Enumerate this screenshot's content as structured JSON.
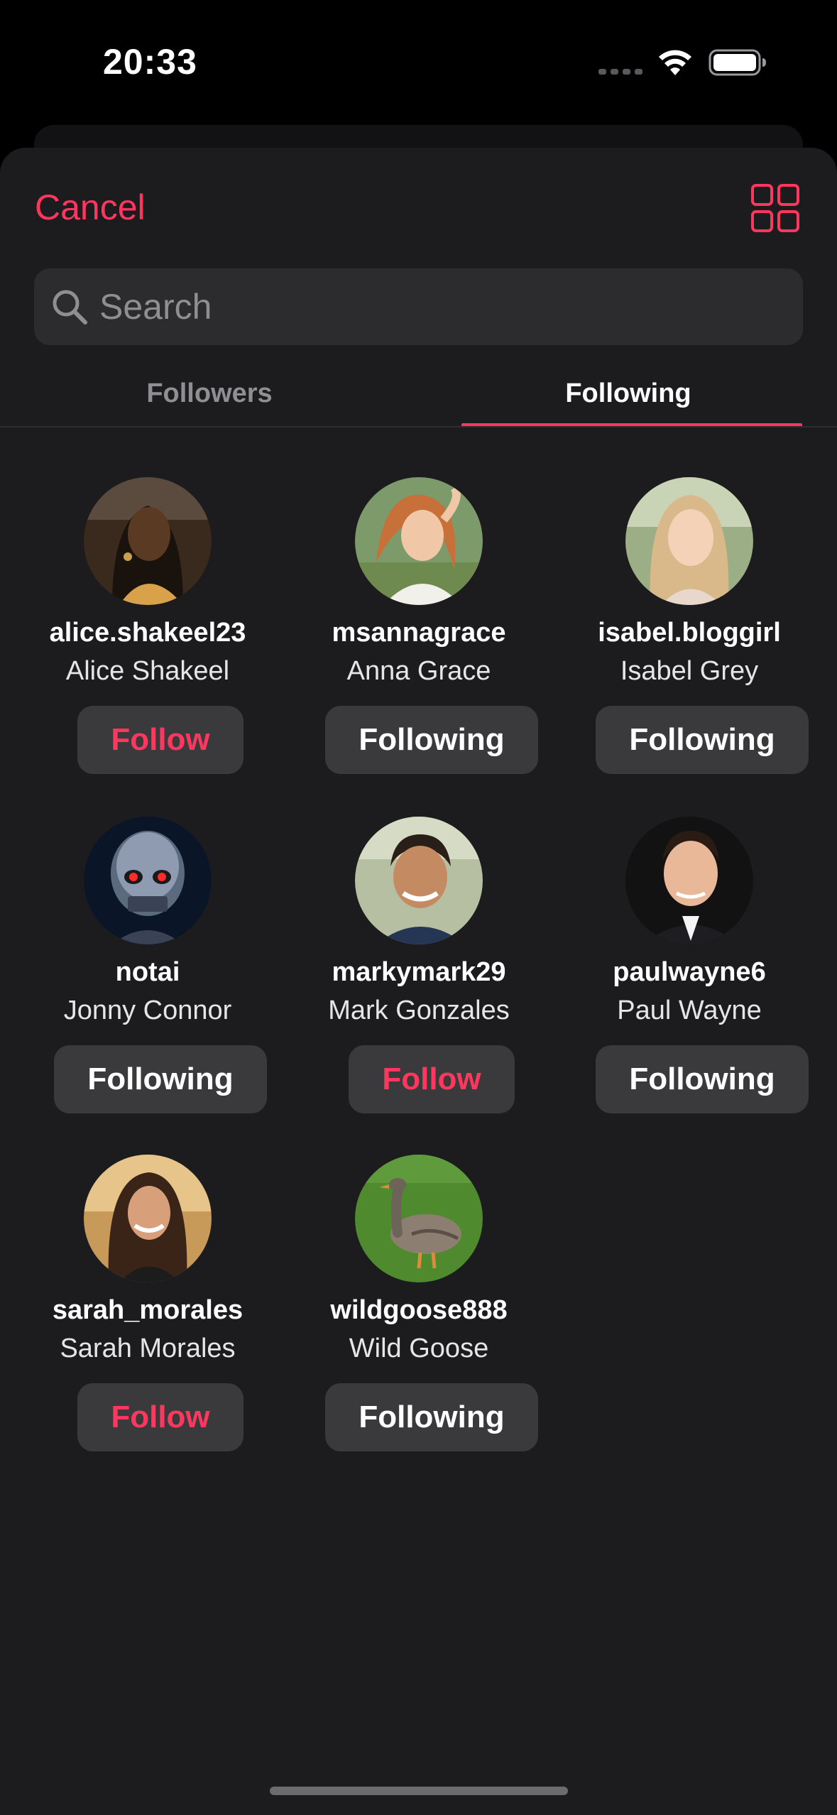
{
  "status_bar": {
    "time": "20:33",
    "icons": [
      "signal-dots-icon",
      "wifi-icon",
      "battery-icon"
    ]
  },
  "colors": {
    "accent": "#ff375f",
    "background": "#000000",
    "sheet": "#1c1c1e",
    "control": "#2c2c2e",
    "button": "#3a3a3c",
    "secondary_text": "#8e8e93"
  },
  "header": {
    "cancel_label": "Cancel",
    "view_toggle_icon": "grid-icon"
  },
  "search": {
    "placeholder": "Search",
    "value": ""
  },
  "tabs": {
    "followers_label": "Followers",
    "following_label": "Following",
    "active": "Following"
  },
  "users": [
    {
      "username": "alice.shakeel23",
      "name": "Alice Shakeel",
      "button": "Follow",
      "avatar": "portrait-photo"
    },
    {
      "username": "msannagrace",
      "name": "Anna Grace",
      "button": "Following",
      "avatar": "portrait-photo"
    },
    {
      "username": "isabel.bloggirl",
      "name": "Isabel Grey",
      "button": "Following",
      "avatar": "portrait-photo"
    },
    {
      "username": "notai",
      "name": "Jonny Connor",
      "button": "Following",
      "avatar": "robot-skull-photo"
    },
    {
      "username": "markymark29",
      "name": "Mark Gonzales",
      "button": "Follow",
      "avatar": "portrait-photo"
    },
    {
      "username": "paulwayne6",
      "name": "Paul Wayne",
      "button": "Following",
      "avatar": "portrait-photo"
    },
    {
      "username": "sarah_morales",
      "name": "Sarah Morales",
      "button": "Follow",
      "avatar": "portrait-photo"
    },
    {
      "username": "wildgoose888",
      "name": "Wild Goose",
      "button": "Following",
      "avatar": "goose-photo"
    }
  ]
}
